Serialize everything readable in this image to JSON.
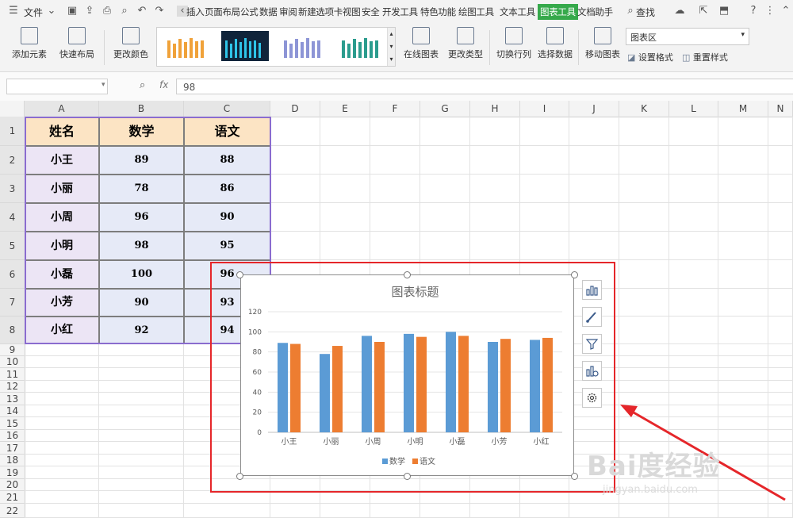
{
  "menubar": {
    "file_label": "文件",
    "tabs": [
      "插入",
      "页面布局",
      "公式",
      "数据",
      "审阅",
      "新建选项卡",
      "视图",
      "安全",
      "开发工具",
      "特色功能",
      "绘图工具",
      "文本工具",
      "图表工具",
      "文档助手"
    ],
    "active_tab": "图表工具",
    "search_label": "查找"
  },
  "ribbon": {
    "add_element": "添加元素",
    "quick_layout": "快速布局",
    "change_color": "更改颜色",
    "online_chart": "在线图表",
    "change_type": "更改类型",
    "switch_row_col": "切换行列",
    "select_data": "选择数据",
    "move_chart": "移动图表",
    "chart_area_combo": "图表区",
    "set_format": "设置格式",
    "reset_style": "重置样式"
  },
  "formula_bar": {
    "fx_label": "fx",
    "value": "98",
    "name_box": ""
  },
  "columns": [
    "A",
    "B",
    "C",
    "D",
    "E",
    "F",
    "G",
    "H",
    "I",
    "J",
    "K",
    "L",
    "M",
    "N"
  ],
  "rows": [
    "1",
    "2",
    "3",
    "4",
    "5",
    "6",
    "7",
    "8",
    "9",
    "10",
    "11",
    "12",
    "13",
    "14",
    "15",
    "16",
    "17",
    "18",
    "19",
    "20",
    "21",
    "22"
  ],
  "table": {
    "headers": [
      "姓名",
      "数学",
      "语文"
    ],
    "rows": [
      {
        "name": "小王",
        "math": "89",
        "chinese": "88"
      },
      {
        "name": "小丽",
        "math": "78",
        "chinese": "86"
      },
      {
        "name": "小周",
        "math": "96",
        "chinese": "90"
      },
      {
        "name": "小明",
        "math": "98",
        "chinese": "95"
      },
      {
        "name": "小磊",
        "math": "100",
        "chinese": "96"
      },
      {
        "name": "小芳",
        "math": "90",
        "chinese": "93"
      },
      {
        "name": "小红",
        "math": "92",
        "chinese": "94"
      }
    ]
  },
  "chart_data": {
    "type": "bar",
    "title": "图表标题",
    "categories": [
      "小王",
      "小丽",
      "小周",
      "小明",
      "小磊",
      "小芳",
      "小红"
    ],
    "series": [
      {
        "name": "数学",
        "color": "#5b9bd5",
        "values": [
          89,
          78,
          96,
          98,
          100,
          90,
          92
        ]
      },
      {
        "name": "语文",
        "color": "#ed7d31",
        "values": [
          88,
          86,
          90,
          95,
          96,
          93,
          94
        ]
      }
    ],
    "ylim": [
      0,
      120
    ],
    "yticks": [
      "0",
      "20",
      "40",
      "60",
      "80",
      "100",
      "120"
    ],
    "grid": true,
    "legend": "bottom"
  },
  "watermark": {
    "main": "Bai度经验",
    "sub": "jingyan.baidu.com"
  },
  "colors": {
    "accent": "#36a94b",
    "highlight_box": "#e5262a"
  }
}
